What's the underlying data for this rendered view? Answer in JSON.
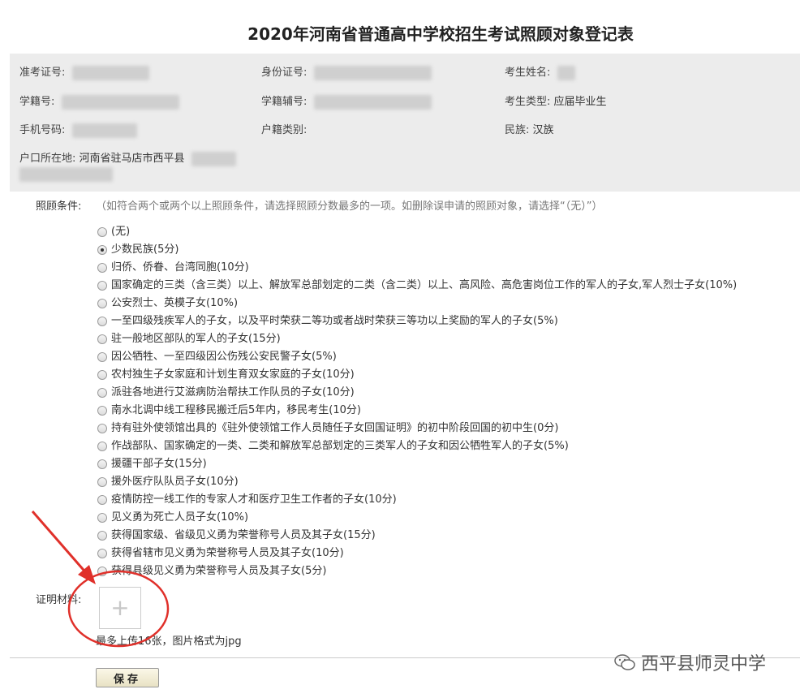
{
  "title": "2020年河南省普通高中学校招生考试照顾对象登记表",
  "info": {
    "exam_no_label": "准考证号:",
    "id_no_label": "身份证号:",
    "name_label": "考生姓名:",
    "student_no_label": "学籍号:",
    "student_aux_label": "学籍辅号:",
    "type_label": "考生类型:",
    "type_value": "应届毕业生",
    "phone_label": "手机号码:",
    "household_type_label": "户籍类别:",
    "ethnicity_label": "民族:",
    "ethnicity_value": "汉族",
    "residence_label": "户口所在地:",
    "residence_value": "河南省驻马店市西平县"
  },
  "conditions": {
    "label": "照顾条件:",
    "hint": "（如符合两个或两个以上照顾条件，请选择照顾分数最多的一项。如删除误申请的照顾对象，请选择“（无）”）",
    "options": [
      {
        "label": "(无)",
        "checked": false
      },
      {
        "label": "少数民族(5分)",
        "checked": true
      },
      {
        "label": "归侨、侨眷、台湾同胞(10分)",
        "checked": false
      },
      {
        "label": "国家确定的三类（含三类）以上、解放军总部划定的二类（含二类）以上、高风险、高危害岗位工作的军人的子女,军人烈士子女(10%)",
        "checked": false
      },
      {
        "label": "公安烈士、英模子女(10%)",
        "checked": false
      },
      {
        "label": "一至四级残疾军人的子女，以及平时荣获二等功或者战时荣获三等功以上奖励的军人的子女(5%)",
        "checked": false
      },
      {
        "label": "驻一般地区部队的军人的子女(15分)",
        "checked": false
      },
      {
        "label": "因公牺牲、一至四级因公伤残公安民警子女(5%)",
        "checked": false
      },
      {
        "label": "农村独生子女家庭和计划生育双女家庭的子女(10分)",
        "checked": false
      },
      {
        "label": "派驻各地进行艾滋病防治帮扶工作队员的子女(10分)",
        "checked": false
      },
      {
        "label": "南水北调中线工程移民搬迁后5年内，移民考生(10分)",
        "checked": false
      },
      {
        "label": "持有驻外使领馆出具的《驻外使领馆工作人员随任子女回国证明》的初中阶段回国的初中生(0分)",
        "checked": false
      },
      {
        "label": "作战部队、国家确定的一类、二类和解放军总部划定的三类军人的子女和因公牺牲军人的子女(5%)",
        "checked": false
      },
      {
        "label": "援疆干部子女(15分)",
        "checked": false
      },
      {
        "label": "援外医疗队队员子女(10分)",
        "checked": false
      },
      {
        "label": "疫情防控一线工作的专家人才和医疗卫生工作者的子女(10分)",
        "checked": false
      },
      {
        "label": "见义勇为死亡人员子女(10%)",
        "checked": false
      },
      {
        "label": "获得国家级、省级见义勇为荣誉称号人员及其子女(15分)",
        "checked": false
      },
      {
        "label": "获得省辖市见义勇为荣誉称号人员及其子女(10分)",
        "checked": false
      },
      {
        "label": "获得县级见义勇为荣誉称号人员及其子女(5分)",
        "checked": false
      }
    ]
  },
  "material": {
    "label": "证明材料:",
    "plus": "+",
    "hint": "最多上传16张，图片格式为jpg"
  },
  "save_label": "保存",
  "watermark": "西平县师灵中学",
  "colors": {
    "annotation": "#e0302a",
    "panel": "#ececec"
  },
  "icons": {
    "upload": "plus-icon",
    "watermark": "wechat-icon",
    "annotation": "arrow-icon"
  }
}
